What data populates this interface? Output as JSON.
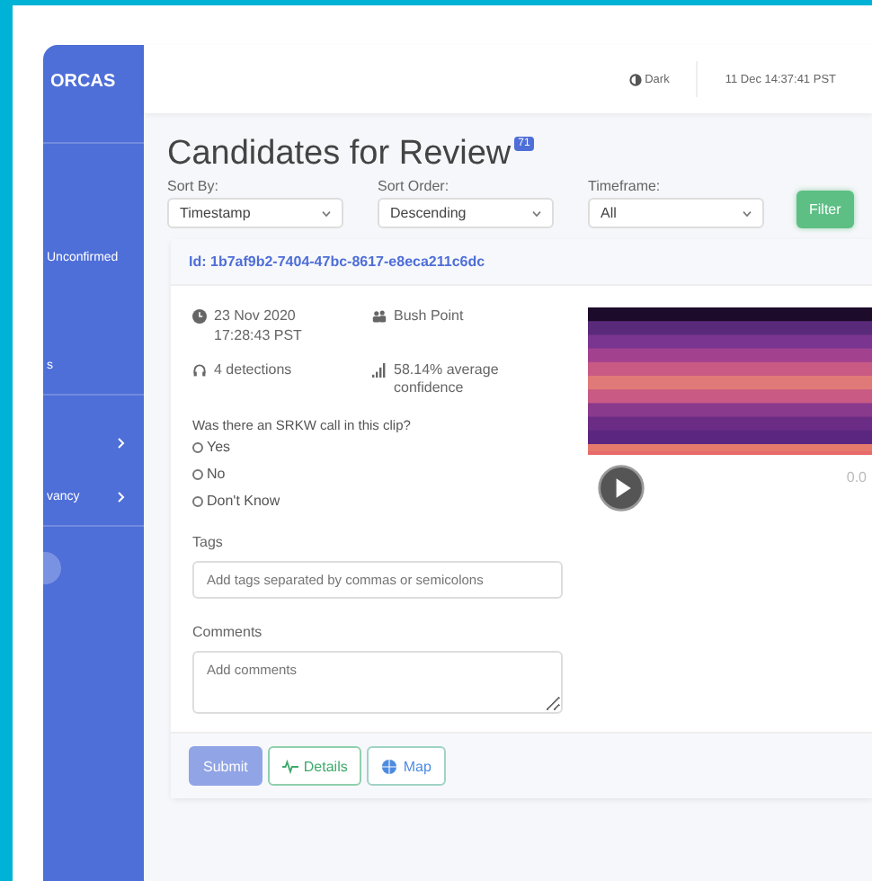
{
  "sidebar": {
    "brand": "ORCAS",
    "items": [
      {
        "label": "Unconfirmed",
        "kind": "link"
      },
      {
        "label": "s",
        "kind": "link"
      },
      {
        "kind": "group"
      },
      {
        "label": "vancy",
        "kind": "group"
      }
    ]
  },
  "topbar": {
    "theme_toggle": "Dark",
    "clock": "11 Dec 14:37:41 PST"
  },
  "page": {
    "title": "Candidates for Review",
    "count": "71"
  },
  "filters": [
    {
      "label": "Sort By:",
      "value": "Timestamp"
    },
    {
      "label": "Sort Order:",
      "value": "Descending"
    },
    {
      "label": "Timeframe:",
      "value": "All"
    }
  ],
  "filter_button": "Filter",
  "candidate": {
    "id": "Id: 1b7af9b2-7404-47bc-8617-e8eca211c6dc",
    "date": "23 Nov 2020",
    "time": "17:28:43 PST",
    "location": "Bush Point",
    "detections": "4 detections",
    "confidence": "58.14% average confidence",
    "audio_time": "0.0",
    "question": "Was there an SRKW call in this clip?",
    "options": [
      {
        "label": "Yes",
        "selected": false
      },
      {
        "label": "No",
        "selected": false
      },
      {
        "label": "Don't Know",
        "selected": false
      }
    ],
    "tags": {
      "label": "Tags",
      "placeholder": "Add tags separated by commas or semicolons"
    },
    "comments": {
      "label": "Comments",
      "placeholder": "Add comments"
    },
    "buttons": [
      {
        "label": "Submit",
        "kind": "submit",
        "disabled": true
      },
      {
        "label": "Details",
        "kind": "details",
        "disabled": false
      },
      {
        "label": "Map",
        "kind": "map",
        "disabled": false
      }
    ]
  }
}
